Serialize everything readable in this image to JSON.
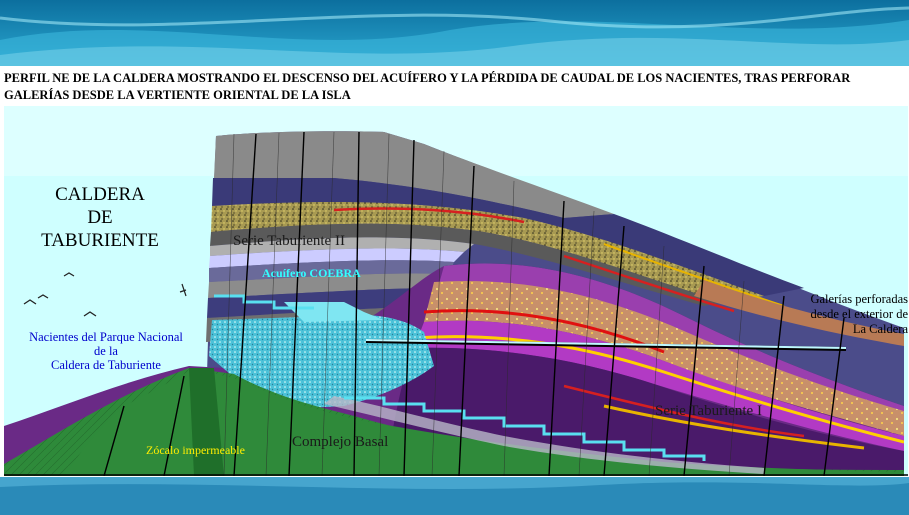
{
  "title": "PERFIL NE DE LA CALDERA MOSTRANDO EL DESCENSO DEL ACUÍFERO Y LA PÉRDIDA DE CAUDAL DE LOS NACIENTES, TRAS PERFORAR GALERÍAS DESDE LA VERTIENTE ORIENTAL DE LA ISLA",
  "labels": {
    "caldera": [
      "CALDERA",
      "DE",
      "TABURIENTE"
    ],
    "nacientes": [
      "Nacientes del Parque Nacional",
      "de la",
      "Caldera de Taburiente"
    ],
    "galerias": [
      "Galerías perforadas",
      "desde el exterior de",
      "La Caldera"
    ],
    "serie_taburiente_2": "Serie Taburiente II",
    "acuifero": "Acuífero COEBRA",
    "serie_taburiente_1": "Serie Taburiente I",
    "complejo_basal": "Complejo Basal",
    "zocalo": "Zócalo impermeable"
  },
  "colors": {
    "sky": "#cfffff",
    "banner": "#1f8fb8",
    "serie_taburiente_2": "#4b4c8a",
    "serie_taburiente_1": "#7a2e8c",
    "complejo_basal": "#2f8a3a",
    "aquifer": "#5fd6e6",
    "gallery_line": "#bff8ff"
  }
}
